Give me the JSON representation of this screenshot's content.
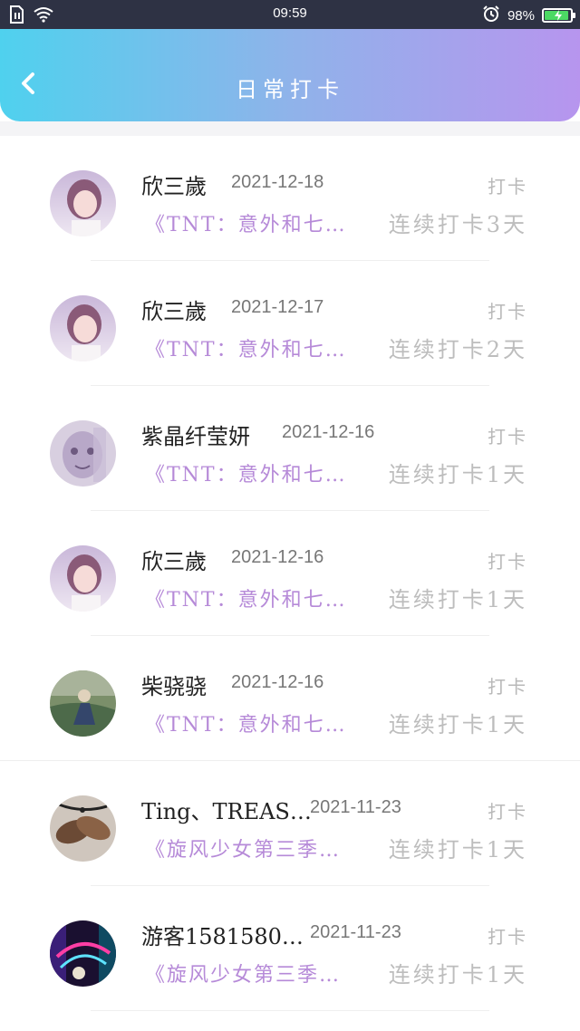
{
  "status_bar": {
    "time": "09:59",
    "battery_percent": "98%",
    "battery_level": 0.98
  },
  "header": {
    "title": "日常打卡",
    "back_icon": "chevron-left-icon",
    "gradient": [
      "#4fd1ee",
      "#b795ee"
    ]
  },
  "colors": {
    "book_title": "#b68ad8",
    "date": "#777777",
    "muted": "#bdbdbd"
  },
  "records": [
    {
      "name": "欣三歲",
      "date": "2021-12-18",
      "action": "打卡",
      "book": "《TNT：意外和七…",
      "streak": "连续打卡3天",
      "avatar": "avatar-girl"
    },
    {
      "name": "欣三歲",
      "date": "2021-12-17",
      "action": "打卡",
      "book": "《TNT：意外和七…",
      "streak": "连续打卡2天",
      "avatar": "avatar-girl"
    },
    {
      "name": "紫晶纤莹妍",
      "date": "2021-12-16",
      "action": "打卡",
      "book": "《TNT：意外和七…",
      "streak": "连续打卡1天",
      "avatar": "avatar-face"
    },
    {
      "name": "欣三歲",
      "date": "2021-12-16",
      "action": "打卡",
      "book": "《TNT：意外和七…",
      "streak": "连续打卡1天",
      "avatar": "avatar-girl"
    },
    {
      "name": "柴骁骁",
      "date": "2021-12-16",
      "action": "打卡",
      "book": "《TNT：意外和七…",
      "streak": "连续打卡1天",
      "avatar": "avatar-scene"
    },
    {
      "name": "Ting、TREAS…",
      "date": "2021-11-23",
      "action": "打卡",
      "book": "《旋风少女第三季…",
      "streak": "连续打卡1天",
      "avatar": "avatar-hands"
    },
    {
      "name": "游客1581580…",
      "date": "2021-11-23",
      "action": "打卡",
      "book": "《旋风少女第三季…",
      "streak": "连续打卡1天",
      "avatar": "avatar-neon"
    }
  ]
}
